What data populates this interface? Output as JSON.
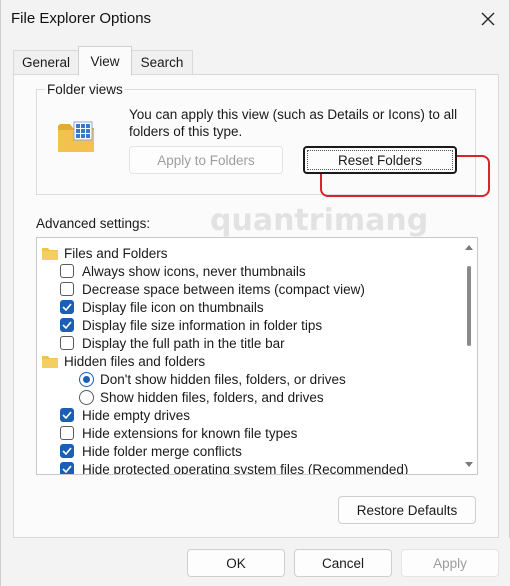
{
  "window": {
    "title": "File Explorer Options"
  },
  "tabs": [
    {
      "label": "General",
      "active": false
    },
    {
      "label": "View",
      "active": true
    },
    {
      "label": "Search",
      "active": false
    }
  ],
  "folder_views": {
    "legend": "Folder views",
    "description": "You can apply this view (such as Details or Icons) to all folders of this type.",
    "apply_label": "Apply to Folders",
    "reset_label": "Reset Folders"
  },
  "advanced": {
    "label": "Advanced settings:",
    "items": [
      {
        "type": "folder",
        "label": "Files and Folders"
      },
      {
        "type": "checkbox",
        "checked": false,
        "label": "Always show icons, never thumbnails"
      },
      {
        "type": "checkbox",
        "checked": false,
        "label": "Decrease space between items (compact view)"
      },
      {
        "type": "checkbox",
        "checked": true,
        "label": "Display file icon on thumbnails"
      },
      {
        "type": "checkbox",
        "checked": true,
        "label": "Display file size information in folder tips"
      },
      {
        "type": "checkbox",
        "checked": false,
        "label": "Display the full path in the title bar"
      },
      {
        "type": "folder",
        "label": "Hidden files and folders"
      },
      {
        "type": "radio",
        "selected": true,
        "label": "Don't show hidden files, folders, or drives"
      },
      {
        "type": "radio",
        "selected": false,
        "label": "Show hidden files, folders, and drives"
      },
      {
        "type": "checkbox",
        "checked": true,
        "label": "Hide empty drives"
      },
      {
        "type": "checkbox",
        "checked": false,
        "label": "Hide extensions for known file types"
      },
      {
        "type": "checkbox",
        "checked": true,
        "label": "Hide folder merge conflicts"
      },
      {
        "type": "checkbox",
        "checked": true,
        "label": "Hide protected operating system files (Recommended)"
      }
    ]
  },
  "restore_label": "Restore Defaults",
  "footer": {
    "ok": "OK",
    "cancel": "Cancel",
    "apply": "Apply"
  },
  "watermark": "quantrimang",
  "colors": {
    "accent": "#1a5fb4",
    "highlight": "#d9232d",
    "folder": "#f2c14e"
  }
}
